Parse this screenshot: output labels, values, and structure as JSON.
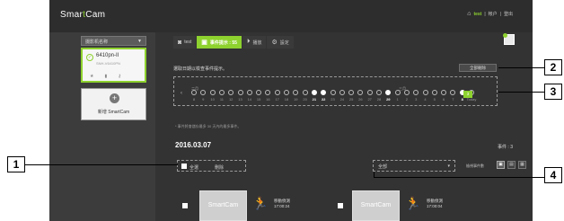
{
  "topbar": {
    "logo": "SmartCam",
    "links": [
      "test",
      "|",
      "帐户",
      "|",
      "登出"
    ],
    "home_icon": "home-icon"
  },
  "sidebar": {
    "camera_selector": "摄影机名称",
    "camera": {
      "name": "6410pn-II",
      "model": "SNH-V6410PN",
      "status_icon": "check-circle-icon",
      "icons": [
        "star-icon",
        "trash-icon",
        "key-icon"
      ]
    },
    "add_camera_label": "新增 SmartCam"
  },
  "tabs": [
    {
      "label": "test",
      "icon": "camera-icon"
    },
    {
      "label": "事件提示 : 55",
      "icon": "event-icon"
    },
    {
      "label": "播放",
      "icon": "play-icon"
    },
    {
      "label": "設定",
      "icon": "gear-icon"
    }
  ],
  "timeline": {
    "title": "選取日期以檢查事件提示。",
    "delete_all": "全部刪除",
    "month_left": "二月",
    "month_right": "三月",
    "days": [
      "8",
      "9",
      "10",
      "11",
      "12",
      "13",
      "14",
      "15",
      "16",
      "17",
      "18",
      "19",
      "20",
      "21",
      "22",
      "23",
      "24",
      "25",
      "26",
      "27",
      "28",
      "29",
      "1",
      "2",
      "3",
      "4",
      "5",
      "6",
      "7",
      "8",
      "Today"
    ],
    "event_days": [
      "21",
      "22",
      "29",
      "7"
    ],
    "event_badge": "3"
  },
  "note": "* 事件將會儲存最多 30 天內的最多事件。",
  "events": {
    "date": "2016.03.07",
    "count_label": "事件 : 3",
    "filter": {
      "select_all": "全選",
      "delete": "刪除"
    },
    "type_select": "全部",
    "view_label": "檢視事件數",
    "list": [
      {
        "type": "移動偵測",
        "time": "17:00:24",
        "thumb": "SmartCam"
      },
      {
        "type": "移動偵測",
        "time": "17:00:04",
        "thumb": "SmartCam"
      }
    ]
  },
  "callouts": [
    "1",
    "2",
    "3",
    "4"
  ],
  "accent": "#8ed22f"
}
